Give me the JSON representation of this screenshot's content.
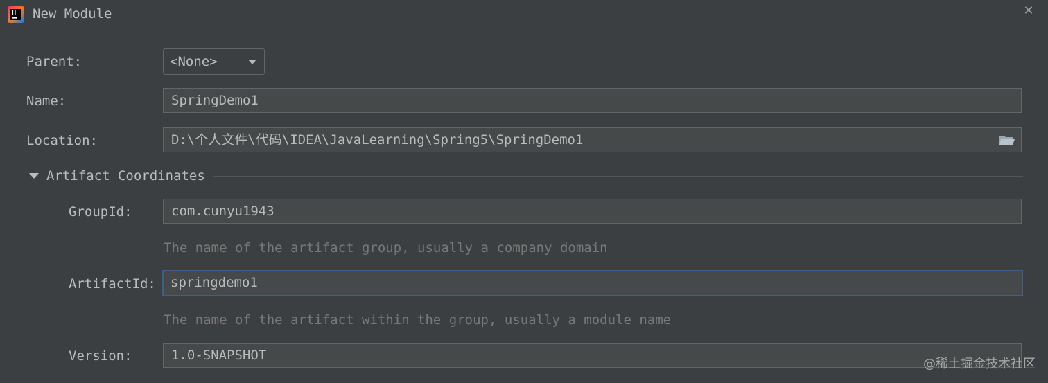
{
  "window": {
    "title": "New Module",
    "close_glyph": "✕"
  },
  "form": {
    "parent": {
      "label": "Parent:",
      "value": "<None>"
    },
    "name": {
      "label": "Name:",
      "value": "SpringDemo1"
    },
    "location": {
      "label": "Location:",
      "value": "D:\\个人文件\\代码\\IDEA\\JavaLearning\\Spring5\\SpringDemo1"
    },
    "section_title": "Artifact Coordinates",
    "group_id": {
      "label": "GroupId:",
      "value": "com.cunyu1943",
      "hint": "The name of the artifact group, usually a company domain"
    },
    "artifact_id": {
      "label": "ArtifactId:",
      "value": "springdemo1",
      "hint": "The name of the artifact within the group, usually a module name"
    },
    "version": {
      "label": "Version:",
      "value": "1.0-SNAPSHOT"
    }
  },
  "watermark": "@稀土掘金技术社区",
  "colors": {
    "background": "#3c3f41",
    "field_bg": "#45494a",
    "focus_border": "#3d6185",
    "text": "#bbbbbb",
    "hint_text": "#787878"
  },
  "icons": {
    "app": "intellij-idea-icon",
    "close": "close-icon",
    "dropdown": "chevron-down-icon",
    "browse": "folder-icon",
    "section_toggle": "triangle-down-icon"
  }
}
